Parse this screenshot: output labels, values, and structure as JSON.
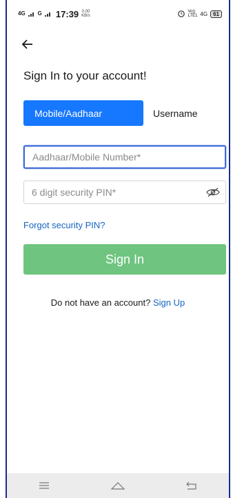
{
  "status_bar": {
    "network_left": "4G",
    "carrier_sub": "G",
    "time": "17:39",
    "speed_value": "0.00",
    "speed_unit": "KB/s",
    "volte": "Vo))\nLTE1",
    "network_right": "4G",
    "battery": "61"
  },
  "header": {
    "back_icon": "arrow-left-icon"
  },
  "form": {
    "title": "Sign In to your account!",
    "tabs": [
      {
        "label": "Mobile/Aadhaar",
        "active": true
      },
      {
        "label": "Username",
        "active": false
      }
    ],
    "id_field": {
      "placeholder": "Aadhaar/Mobile Number*",
      "value": ""
    },
    "pin_field": {
      "placeholder": "6 digit security PIN*",
      "value": ""
    },
    "pin_toggle_icon": "eye-slash-icon",
    "forgot_label": "Forgot security PIN?",
    "submit_label": "Sign In",
    "signup_prompt": "Do not have an account?",
    "signup_label": "Sign Up"
  },
  "nav_bar": {
    "items": [
      "menu-icon",
      "home-icon",
      "back-icon"
    ]
  },
  "colors": {
    "primary": "#1677ff",
    "link": "#1565c0",
    "submit": "#6fc47f",
    "frame_border": "#1a2a8f"
  }
}
